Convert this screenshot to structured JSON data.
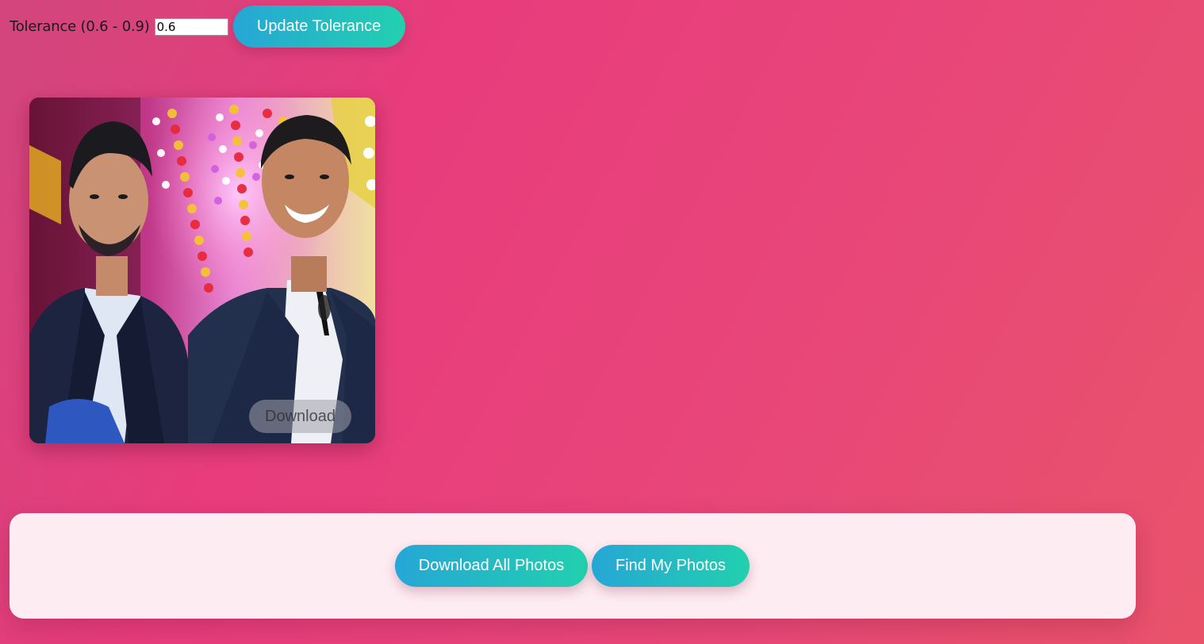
{
  "tolerance": {
    "label": "Tolerance (0.6 - 0.9)",
    "value": "0.6",
    "update_label": "Update Tolerance"
  },
  "photo": {
    "download_label": "Download"
  },
  "actions": {
    "download_all_label": "Download All Photos",
    "find_label": "Find My Photos"
  },
  "colors": {
    "button_gradient_start": "#26a6d6",
    "button_gradient_end": "#22d0ae",
    "background_primary": "#e83c7c",
    "panel_background": "#fdecf1"
  }
}
